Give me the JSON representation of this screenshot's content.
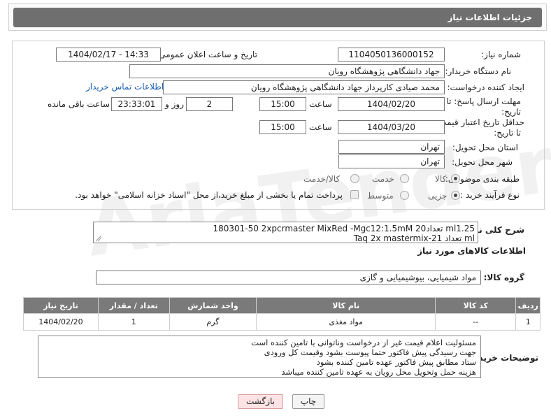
{
  "header": {
    "title": "جزئیات اطلاعات نیاز"
  },
  "form": {
    "need_number_label": "شماره نیاز:",
    "need_number": "1104050136000152",
    "announce_label": "تاریخ و ساعت اعلان عمومی:",
    "announce_value": "1404/02/17 - 14:33",
    "buyer_org_label": "نام دستگاه خریدار:",
    "buyer_org": "جهاد دانشگاهی پژوهشگاه رویان",
    "requester_label": "ایجاد کننده درخواست:",
    "requester": "محمد صیادی کارپرداز جهاد دانشگاهی پژوهشگاه رویان",
    "contact_link": "اطلاعات تماس خریدار",
    "deadline_label_1": "مهلت ارسال پاسخ: تا",
    "deadline_label_2": "تاریخ:",
    "deadline_date": "1404/02/20",
    "time_label": "ساعت",
    "deadline_time": "15:00",
    "days_value": "2",
    "days_label": "روز و",
    "remaining_time": "23:33:01",
    "remaining_label": "ساعت باقی مانده",
    "validity_label_1": "حداقل تاریخ اعتبار قیمت:",
    "validity_label_2": "تا تاریخ:",
    "validity_date": "1404/03/20",
    "validity_time_label": "ساعت",
    "validity_time": "15:00",
    "province_label": "استان محل تحویل:",
    "province": "تهران",
    "city_label": "شهر محل تحویل:",
    "city": "تهران",
    "category_label": "طبقه بندی موضوعی:",
    "category_options": [
      "کالا",
      "خدمت",
      "کالا/خدمت"
    ],
    "category_selected": "کالا",
    "process_label": "نوع فرآیند خرید :",
    "process_options": [
      "جزیی",
      "متوسط"
    ],
    "process_selected": "جزیی",
    "payment_note": "پرداخت تمام یا بخشی از مبلغ خرید،از محل \"اسناد خزانه اسلامی\" خواهد بود."
  },
  "description": {
    "label": "شرح کلی نیاز:",
    "line1": "180301-50 2xpcrmaster MixRed -Mgc12:1.5mM تعداد20 ml1.25",
    "line2": "Taq 2x mastermix-2تعداد 1 ml"
  },
  "goods": {
    "section_title": "اطلاعات کالاهای مورد نیاز",
    "group_label": "گروه کالا:",
    "group_value": "مواد شیمیایی، بیوشیمیایی و  گازی",
    "columns": [
      "ردیف",
      "کد کالا",
      "نام کالا",
      "واحد شمارش",
      "تعداد / مقدار",
      "تاریخ نیاز"
    ],
    "rows": [
      {
        "index": "1",
        "code": "--",
        "name": "مواد مغذی",
        "unit": "گرم",
        "qty": "1",
        "date": "1404/02/20"
      }
    ]
  },
  "buyer_notes": {
    "label": "توضیحات خریدار:",
    "lines": [
      "مسئولیت اعلام قیمت  غیر از درخواست وناتوانی با تامین کننده است",
      "جهت رسیدگی پیش فاکتور حتما پیوست بشود وقیمت کل ورودی",
      "ستاد مطابق پیش فاکتور عهده تامین کننده بشود",
      "هزینه حمل وتحویل محل رویان به عهده تامین کننده میباشد"
    ]
  },
  "buttons": {
    "print": "چاپ",
    "back": "بازگشت"
  },
  "watermark": "AriaTender.neT"
}
